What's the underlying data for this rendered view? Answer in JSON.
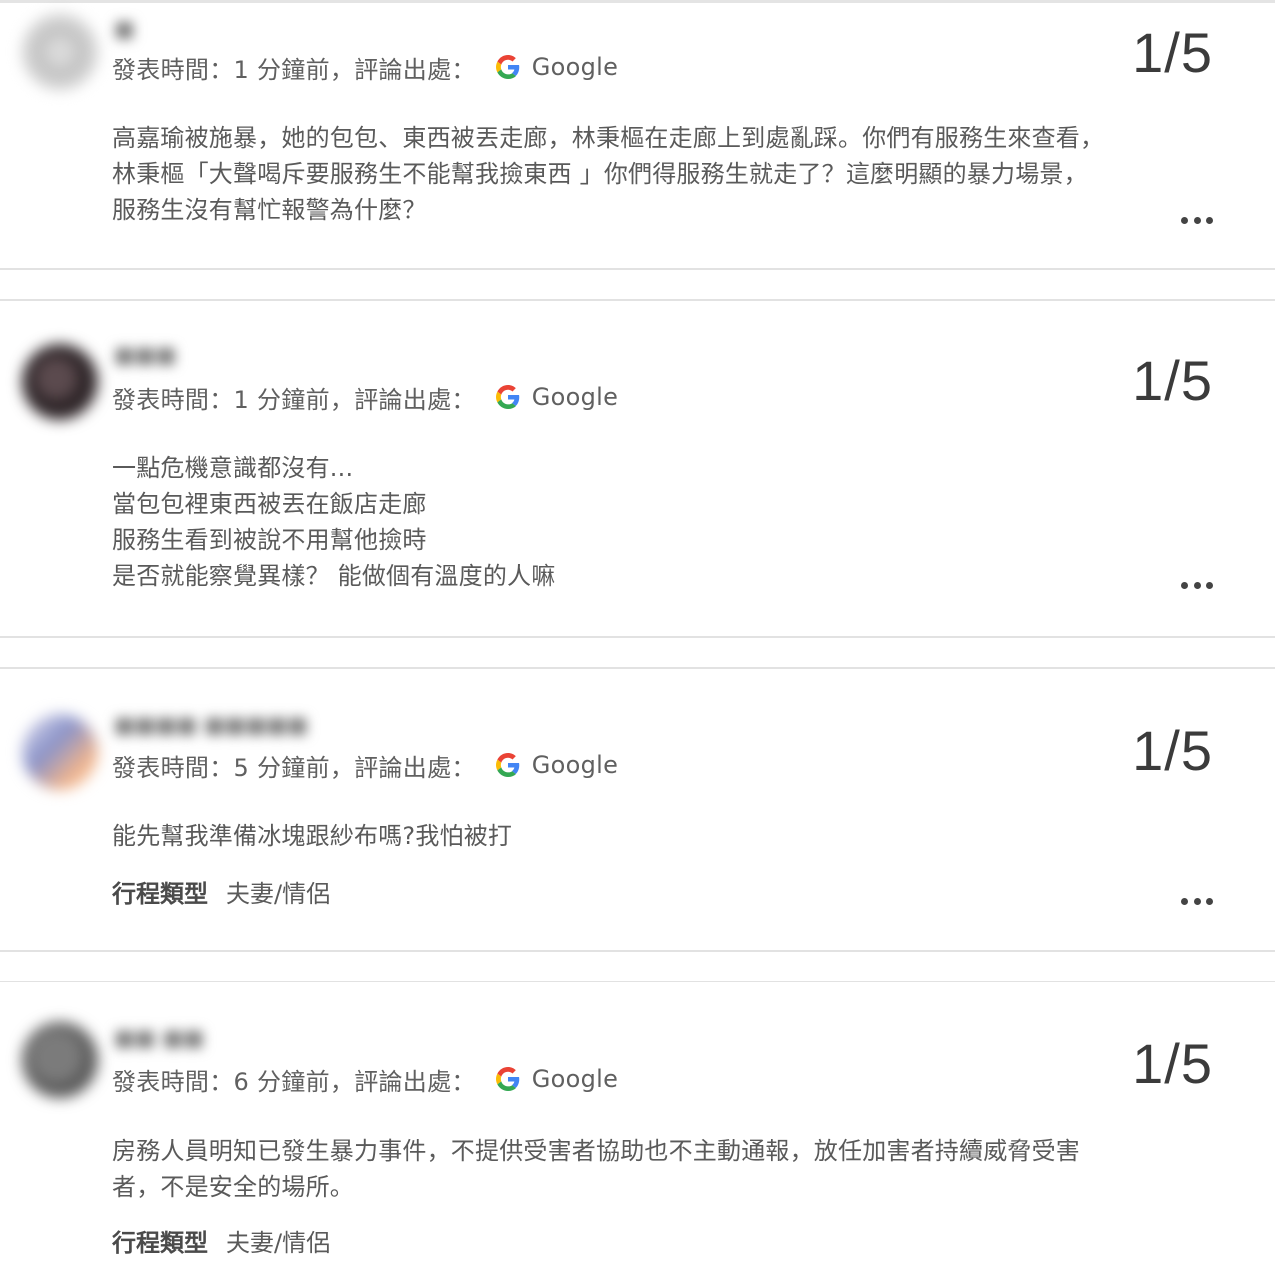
{
  "reviews": [
    {
      "name": "■",
      "posted_label": "發表時間：",
      "posted_time": "1 分鐘前",
      "source_label": "，評論出處：",
      "source": "Google",
      "rating": "1/5",
      "lines": [
        "高嘉瑜被施暴，她的包包、東西被丟走廊，林秉樞在走廊上到處亂踩。你們有服務生來查看，",
        "林秉樞「大聲喝斥要服務生不能幫我撿東西 」你們得服務生就走了？這麼明顯的暴力場景，",
        "服務生沒有幫忙報警為什麼？"
      ]
    },
    {
      "name": "■■■",
      "posted_label": "發表時間：",
      "posted_time": "1 分鐘前",
      "source_label": "，評論出處：",
      "source": "Google",
      "rating": "1/5",
      "lines": [
        "一點危機意識都沒有...",
        "當包包裡東西被丟在飯店走廊",
        "服務生看到被說不用幫他撿時",
        "是否就能察覺異樣？ 能做個有溫度的人嘛"
      ]
    },
    {
      "name": "■■■■ ■■■■■",
      "posted_label": "發表時間：",
      "posted_time": "5 分鐘前",
      "source_label": "，評論出處：",
      "source": "Google",
      "rating": "1/5",
      "lines": [
        "能先幫我準備冰塊跟紗布嗎?我怕被打"
      ],
      "trip_label": "行程類型",
      "trip_value": "夫妻/情侶"
    },
    {
      "name": "■■ ■■",
      "posted_label": "發表時間：",
      "posted_time": "6 分鐘前",
      "source_label": "，評論出處：",
      "source": "Google",
      "rating": "1/5",
      "lines": [
        "房務人員明知已發生暴力事件，不提供受害者協助也不主動通報，放任加害者持續威脅受害",
        "者，不是安全的場所。"
      ],
      "trip_label": "行程類型",
      "trip_value": "夫妻/情侶"
    }
  ]
}
